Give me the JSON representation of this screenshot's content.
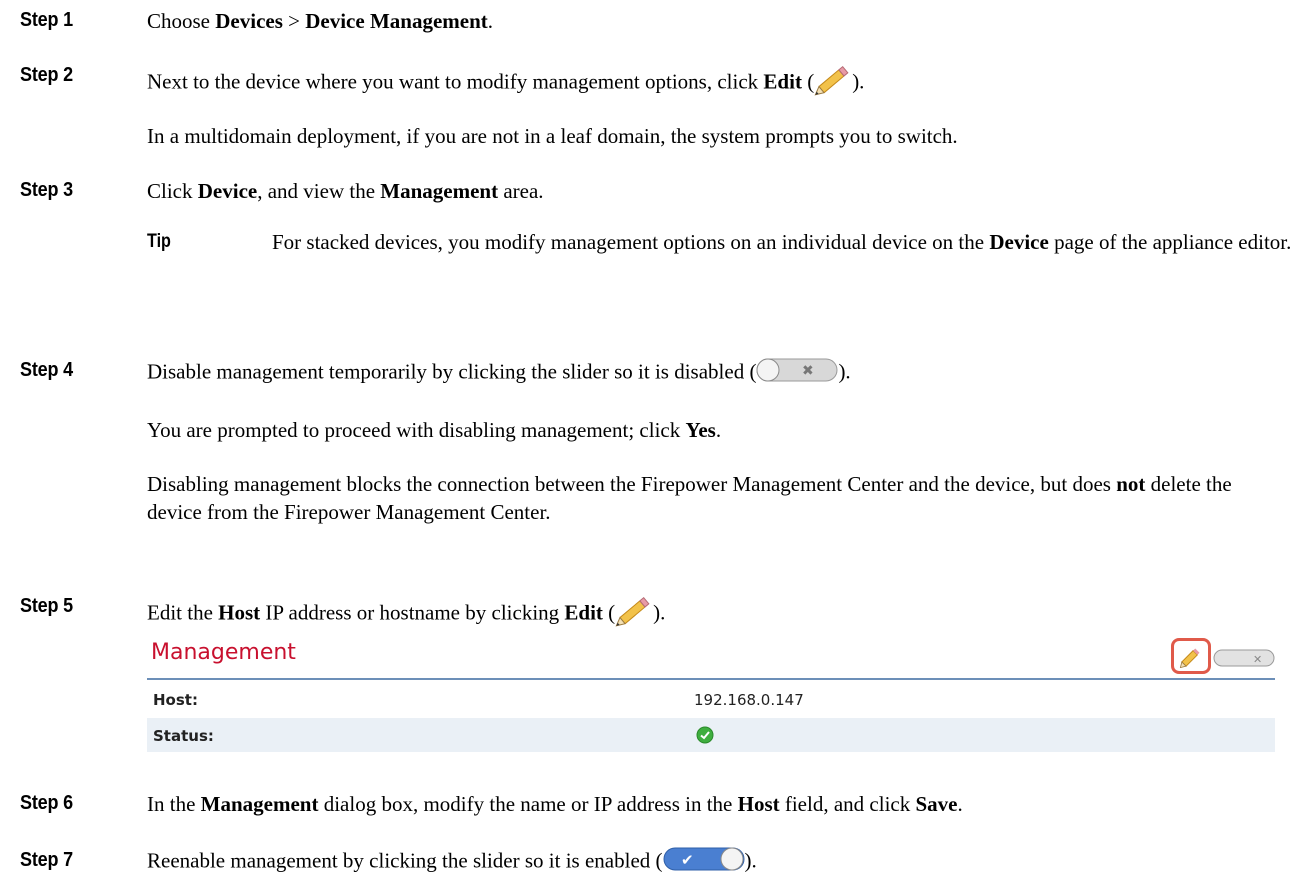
{
  "steps": [
    {
      "label": "Step 1",
      "pre": "Choose ",
      "b1": "Devices",
      "mid": " > ",
      "b2": "Device Management",
      "post": "."
    },
    {
      "label": "Step 2",
      "pre": "Next to the device where you want to modify management options, click ",
      "b1": "Edit",
      "post_open": " (",
      "post_close": ").",
      "cont": "In a multidomain deployment, if you are not in a leaf domain, the system prompts you to switch."
    },
    {
      "label": "Step 3",
      "pre": "Click ",
      "b1": "Device",
      "mid": ", and view the ",
      "b2": "Management",
      "post": " area.",
      "tip_label": "Tip",
      "tip_pre": "For stacked devices, you modify management options on an individual device on the ",
      "tip_b": "Device",
      "tip_post": " page of the appliance editor."
    },
    {
      "label": "Step 4",
      "pre": "Disable management temporarily by clicking the slider so it is disabled (",
      "post": ").",
      "cont1_pre": "You are prompted to proceed with disabling management; click ",
      "cont1_b": "Yes",
      "cont1_post": ".",
      "cont2_pre": "Disabling management blocks the connection between the Firepower Management Center and the device, but does ",
      "cont2_b": "not",
      "cont2_post": " delete the device from the Firepower Management Center."
    },
    {
      "label": "Step 5",
      "pre": "Edit the ",
      "b1": "Host",
      "mid": " IP address or hostname by clicking ",
      "b2": "Edit",
      "post_open": " (",
      "post_close": ")."
    },
    {
      "label": "Step 6",
      "pre": "In the ",
      "b1": "Management",
      "mid": " dialog box, modify the name or IP address in the ",
      "b2": "Host",
      "mid2": " field, and click ",
      "b3": "Save",
      "post": "."
    },
    {
      "label": "Step 7",
      "pre": "Reenable management by clicking the slider so it is enabled (",
      "post": ")."
    }
  ],
  "management": {
    "title": "Management",
    "host_label": "Host:",
    "host_value": "192.168.0.147",
    "status_label": "Status:",
    "status_icon": "check-circle-icon"
  },
  "colors": {
    "title_red": "#c8102e",
    "rule_blue": "#6c8fb8",
    "row_alt": "#eaf0f6",
    "highlight": "#e05a4a",
    "status_green": "#3fae3f"
  }
}
